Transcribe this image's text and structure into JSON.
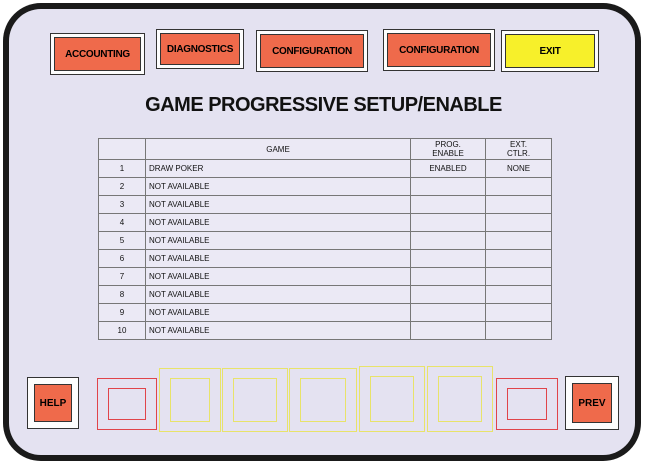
{
  "toolbar": {
    "accounting": "ACCOUNTING",
    "diagnostics": "DIAGNOSTICS",
    "configuration_1": "CONFIGURATION",
    "configuration_2": "CONFIGURATION",
    "exit": "EXIT"
  },
  "title": "GAME PROGRESSIVE SETUP/ENABLE",
  "table": {
    "headers": {
      "num": "",
      "game": "GAME",
      "prog_enable": "PROG.\nENABLE",
      "ext_ctlr": "EXT.\nCTLR."
    },
    "rows": [
      {
        "num": "1",
        "game": "DRAW POKER",
        "prog": "ENABLED",
        "ext": "NONE"
      },
      {
        "num": "2",
        "game": "NOT AVAILABLE",
        "prog": "",
        "ext": ""
      },
      {
        "num": "3",
        "game": "NOT AVAILABLE",
        "prog": "",
        "ext": ""
      },
      {
        "num": "4",
        "game": "NOT AVAILABLE",
        "prog": "",
        "ext": ""
      },
      {
        "num": "5",
        "game": "NOT AVAILABLE",
        "prog": "",
        "ext": ""
      },
      {
        "num": "6",
        "game": "NOT AVAILABLE",
        "prog": "",
        "ext": ""
      },
      {
        "num": "7",
        "game": "NOT AVAILABLE",
        "prog": "",
        "ext": ""
      },
      {
        "num": "8",
        "game": "NOT AVAILABLE",
        "prog": "",
        "ext": ""
      },
      {
        "num": "9",
        "game": "NOT AVAILABLE",
        "prog": "",
        "ext": ""
      },
      {
        "num": "10",
        "game": "NOT AVAILABLE",
        "prog": "",
        "ext": ""
      }
    ]
  },
  "bottom": {
    "help": "HELP",
    "prev": "PREV"
  },
  "colors": {
    "screen_bg": "#e4e2f1",
    "button_orange": "#ef6a4b",
    "button_yellow": "#f7f02a",
    "slot_red": "#e0444a",
    "slot_yellow": "#e8e36a"
  }
}
